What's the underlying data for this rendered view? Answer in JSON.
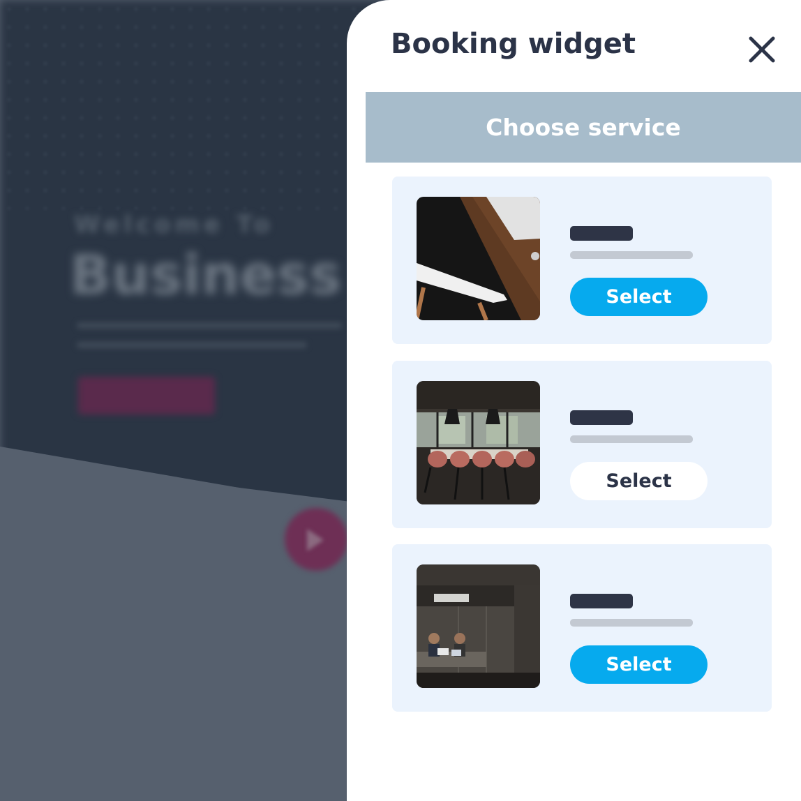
{
  "background": {
    "welcome_text": "Welcome To",
    "headline": "Business"
  },
  "widget": {
    "title": "Booking widget",
    "close_icon": "close-icon",
    "section_title": "Choose service",
    "services": [
      {
        "image": "chair-desk-photo",
        "select_label": "Select",
        "selected": true
      },
      {
        "image": "meeting-room-photo",
        "select_label": "Select",
        "selected": false
      },
      {
        "image": "office-team-photo",
        "select_label": "Select",
        "selected": true
      }
    ]
  },
  "colors": {
    "accent": "#06aaee",
    "header_bar": "#a7bccb",
    "card_bg": "#ebf3fd",
    "title_text": "#2b3347"
  }
}
